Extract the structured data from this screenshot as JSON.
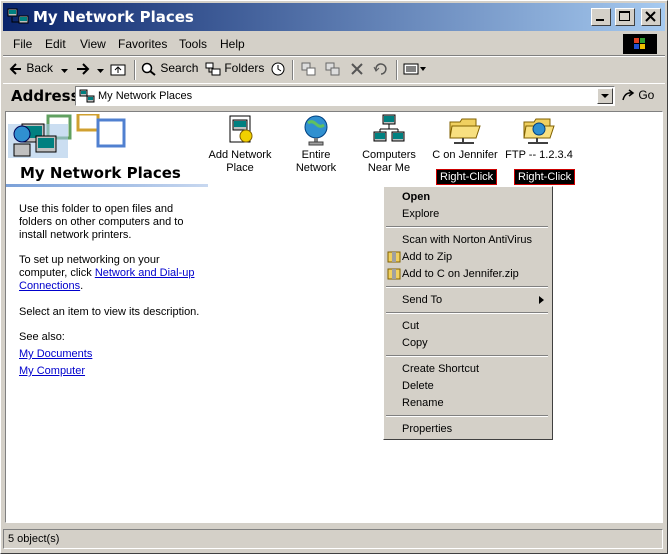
{
  "window": {
    "title": "My Network Places"
  },
  "menu": [
    "File",
    "Edit",
    "View",
    "Favorites",
    "Tools",
    "Help"
  ],
  "toolbar": {
    "back": "Back",
    "search": "Search",
    "folders": "Folders"
  },
  "address": {
    "label": "Address",
    "value": "My Network Places",
    "go": "Go"
  },
  "left_pane": {
    "title": "My Network Places",
    "desc1": "Use this folder to open files and folders on other computers and to install network printers.",
    "desc2_prefix": "To set up networking on your computer, click ",
    "desc2_link": "Network and Dial-up Connections",
    "desc2_suffix": ".",
    "desc3": "Select an item to view its description.",
    "see_also": "See also:",
    "links": [
      "My Documents",
      "My Computer"
    ]
  },
  "items": [
    {
      "label": "Add Network Place",
      "icon": "add-network-place-icon"
    },
    {
      "label": "Entire Network",
      "icon": "globe-icon"
    },
    {
      "label": "Computers Near Me",
      "icon": "computers-icon"
    },
    {
      "label": "C on Jennifer",
      "icon": "network-folder-icon"
    },
    {
      "label": "FTP -- 1.2.3.4",
      "icon": "ftp-folder-icon"
    }
  ],
  "right_click_labels": [
    "Right-Click",
    "Right-Click"
  ],
  "context_menu": {
    "open": "Open",
    "explore": "Explore",
    "scan": "Scan with Norton AntiVirus",
    "add_zip": "Add to Zip",
    "add_named_zip": "Add to C on Jennifer.zip",
    "send_to": "Send To",
    "cut": "Cut",
    "copy": "Copy",
    "create_shortcut": "Create Shortcut",
    "delete": "Delete",
    "rename": "Rename",
    "properties": "Properties"
  },
  "status": {
    "text": "5 object(s)"
  }
}
